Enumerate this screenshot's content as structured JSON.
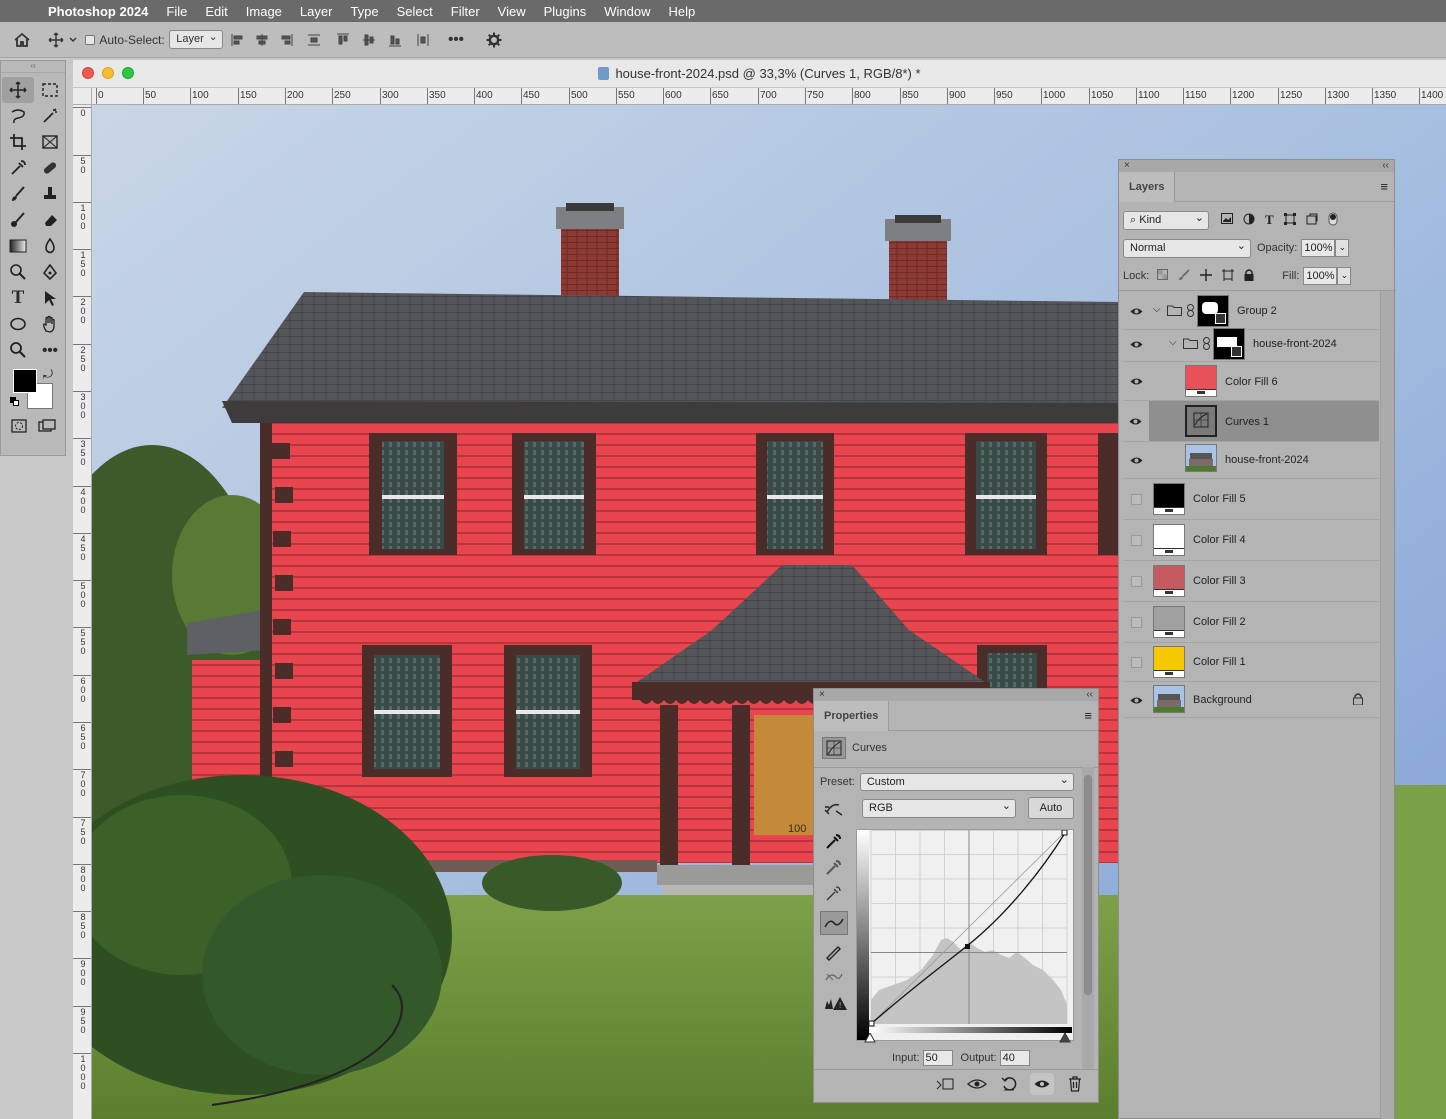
{
  "menu": {
    "apple_icon": "apple-icon",
    "app": "Photoshop 2024",
    "items": [
      "File",
      "Edit",
      "Image",
      "Layer",
      "Type",
      "Select",
      "Filter",
      "View",
      "Plugins",
      "Window",
      "Help"
    ]
  },
  "options_bar": {
    "auto_select_label": "Auto-Select:",
    "auto_select_value": "Layer"
  },
  "document": {
    "title": "house-front-2024.psd @ 33,3% (Curves 1, RGB/8*) *",
    "ruler_h": [
      "0",
      "50",
      "100",
      "150",
      "200",
      "250",
      "300",
      "350",
      "400",
      "450",
      "500",
      "550",
      "600",
      "650",
      "700",
      "750",
      "800",
      "850",
      "900",
      "950",
      "1000",
      "1050",
      "1100",
      "1150",
      "1200",
      "1250",
      "1300",
      "1350",
      "1400"
    ],
    "ruler_v": [
      "0",
      "50",
      "100",
      "150",
      "200",
      "250",
      "300",
      "350",
      "400",
      "450",
      "500",
      "550",
      "600",
      "650",
      "700",
      "750",
      "800",
      "850",
      "900",
      "950",
      "1000"
    ],
    "door_number": "100"
  },
  "layers_panel": {
    "tab": "Layers",
    "filter_kind": "Kind",
    "blend_mode": "Normal",
    "opacity_label": "Opacity:",
    "opacity_value": "100%",
    "lock_label": "Lock:",
    "fill_label": "Fill:",
    "fill_value": "100%",
    "layers": [
      {
        "name": "Group 2",
        "visible": true,
        "type": "group"
      },
      {
        "name": "house-front-2024",
        "visible": true,
        "type": "group"
      },
      {
        "name": "Color Fill 6",
        "visible": true,
        "type": "fill",
        "color": "#e8505a"
      },
      {
        "name": "Curves 1",
        "visible": true,
        "type": "curves",
        "selected": true
      },
      {
        "name": "house-front-2024",
        "visible": true,
        "type": "image"
      },
      {
        "name": "Color Fill 5",
        "visible": false,
        "type": "fill",
        "color": "#000000"
      },
      {
        "name": "Color Fill 4",
        "visible": false,
        "type": "fill",
        "color": "#ffffff"
      },
      {
        "name": "Color Fill 3",
        "visible": false,
        "type": "fill",
        "color": "#c55a60"
      },
      {
        "name": "Color Fill 2",
        "visible": false,
        "type": "fill",
        "color": "#a0a0a0"
      },
      {
        "name": "Color Fill 1",
        "visible": false,
        "type": "fill",
        "color": "#f5c800"
      },
      {
        "name": "Background",
        "visible": true,
        "type": "image",
        "locked": true
      }
    ]
  },
  "properties_panel": {
    "tab": "Properties",
    "adjustment": "Curves",
    "preset_label": "Preset:",
    "preset_value": "Custom",
    "channel": "RGB",
    "auto_label": "Auto",
    "input_label": "Input:",
    "input_value": "50",
    "output_label": "Output:",
    "output_value": "40"
  },
  "colors": {
    "foreground": "#000000",
    "background": "#ffffff",
    "siding": "#e8454e",
    "sky": "#a9c3e4"
  }
}
